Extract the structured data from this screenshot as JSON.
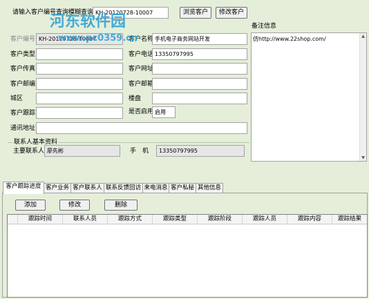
{
  "query": {
    "label": "请输入客户编号查询模糊查询",
    "value": "KH-20120728-10007",
    "browse_button": "浏览客户",
    "edit_button": "修改客户"
  },
  "form": {
    "customer_id_label": "客户编号",
    "customer_id_value": "KH-20120728-10007",
    "customer_name_label": "客户名称",
    "customer_name_value": "手机电子商务网站开发",
    "customer_type_label": "客户类型",
    "customer_type_value": "",
    "customer_phone_label": "客户电话",
    "customer_phone_value": "13350797995",
    "customer_fax_label": "客户传真",
    "customer_fax_value": "",
    "customer_website_label": "客户网址",
    "customer_website_value": "",
    "customer_postcode_label": "客户邮编",
    "customer_postcode_value": "",
    "customer_email_label": "客户邮箱",
    "customer_email_value": "",
    "district_label": "城区",
    "district_value": "",
    "building_label": "楼盘",
    "building_value": "",
    "followup_label": "客户跟踪",
    "followup_value": "",
    "enabled_label": "是否启用",
    "enabled_value": "启用",
    "address_label": "通讯地址",
    "address_value": ""
  },
  "contact": {
    "section_title": "联系人基本资料",
    "main_contact_label": "主要联系人",
    "main_contact_value": "廖先彬",
    "mobile_label": "手　机",
    "mobile_value": "13350797995"
  },
  "notes": {
    "label": "备注信息",
    "value": "仿http://www.22shop.com/"
  },
  "watermark": {
    "line1": "河东软件园",
    "line2": "www.pc0359.cn"
  },
  "tabs": [
    "客户跟踪进度",
    "客户业务",
    "客户联系人",
    "联系反馈回访",
    "来电消息",
    "客户私秘",
    "其他信息"
  ],
  "actions": {
    "add": "添加",
    "edit": "修改",
    "delete": "删除"
  },
  "grid": {
    "columns": [
      "跟踪时间",
      "联系人员",
      "跟踪方式",
      "跟踪类型",
      "跟踪阶段",
      "跟踪人员",
      "跟踪内容",
      "跟踪结果"
    ]
  },
  "colors": {
    "background": "#e4eed9",
    "watermark": "#2a9fd6"
  }
}
